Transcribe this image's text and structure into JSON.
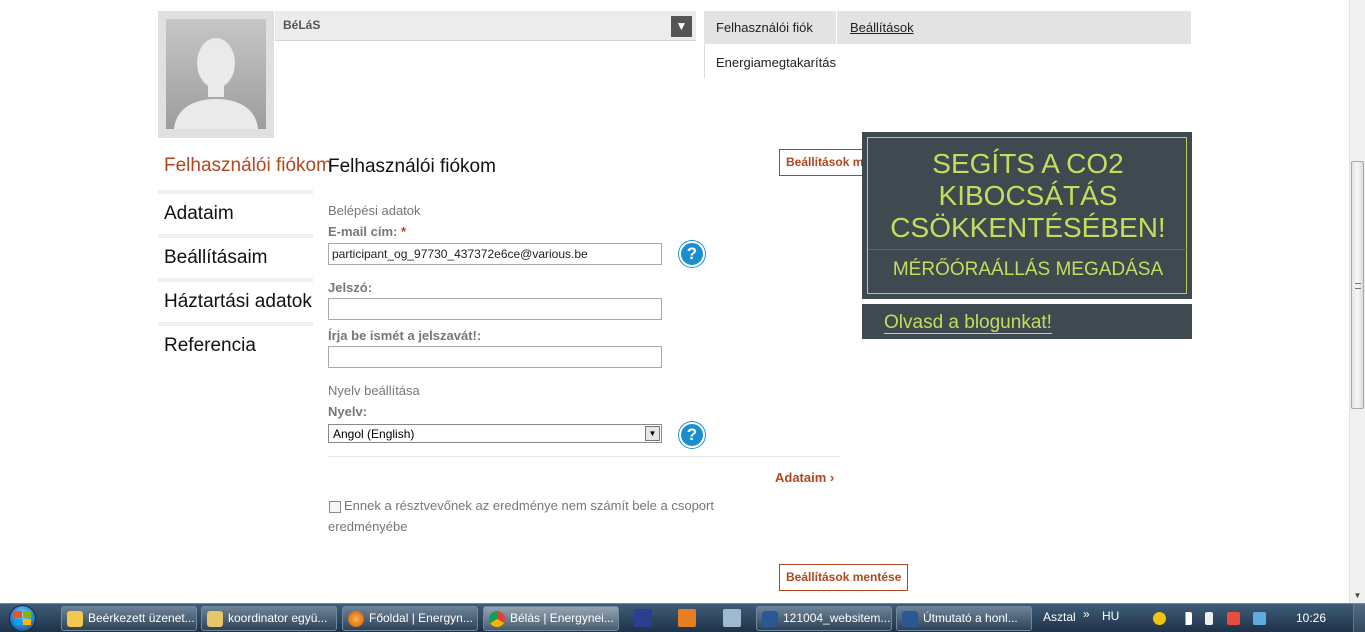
{
  "user": {
    "name": "BéLáS",
    "dropdown_icon": "chevron-down-icon"
  },
  "topnav": {
    "tabs": [
      {
        "label": "Felhasználói fiók"
      },
      {
        "label": "Beállítások"
      }
    ],
    "subnav_item": "Energiamegtakarítás"
  },
  "left_menu": {
    "items": [
      {
        "label": "Felhasználói fiókom"
      },
      {
        "label": "Adataim"
      },
      {
        "label": "Beállításaim"
      },
      {
        "label": "Háztartási adatok"
      },
      {
        "label": "Referencia"
      }
    ]
  },
  "form": {
    "title": "Felhasználói fiókom",
    "save_label_top": "Beállítások mentése",
    "save_label_bottom": "Beállítások mentése",
    "login_section": "Belépési adatok",
    "email_label": "E-mail cím:",
    "email_required": "*",
    "email_value": "participant_og_97730_437372e6ce@various.be",
    "password_label": "Jelszó:",
    "password_value": "",
    "password_repeat_label": "Írja be ismét a jelszavát!:",
    "password_repeat_value": "",
    "language_section": "Nyelv beállítása",
    "language_label": "Nyelv:",
    "language_value": "Angol (English)",
    "help_glyph": "?",
    "next_link": "Adataim ›",
    "exclude_label": "Ennek a résztvevőnek az eredménye nem számít bele a csoport eredményébe",
    "exclude_checked": false
  },
  "banner": {
    "title": "SEGÍTS A CO2 KIBOCSÁTÁS CSÖKKENTÉSÉBEN!",
    "cta": "MÉRŐÓRAÁLLÁS MEGADÁSA",
    "blog_link": "Olvasd a blogunkat!",
    "bg_color": "#3e4a50",
    "accent_color": "#c6dc5c"
  },
  "colors": {
    "accent": "#b0471f",
    "help": "#1a8fcf"
  },
  "taskbar": {
    "tasks": [
      {
        "label": "Beérkezett üzenet...",
        "icon": "mail-icon"
      },
      {
        "label": "koordinator együ...",
        "icon": "folder-icon"
      },
      {
        "label": "Főoldal | Energyn...",
        "icon": "firefox-icon"
      },
      {
        "label": "Bélás | Energynei...",
        "icon": "chrome-icon"
      },
      {
        "label": "121004_websitem...",
        "icon": "word-icon"
      },
      {
        "label": "Útmutató a honl...",
        "icon": "word-icon"
      }
    ],
    "desktop_label": "Asztal",
    "language": "HU",
    "clock": "10:26"
  }
}
